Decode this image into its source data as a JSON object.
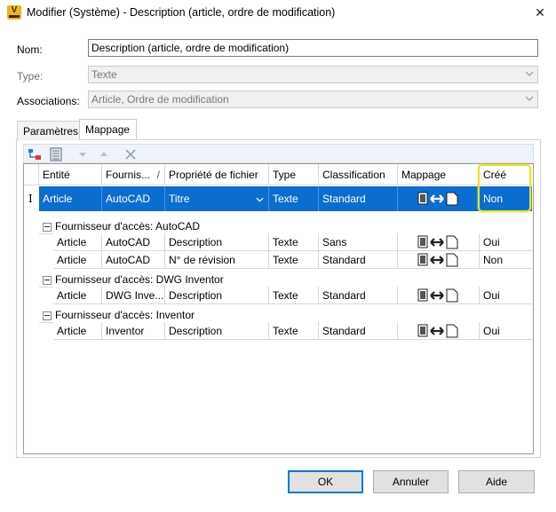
{
  "window": {
    "title": "Modifier (Système) - Description (article, ordre de modification)",
    "close_glyph": "✕",
    "app_icon_letter": "V"
  },
  "form": {
    "name_label": "Nom:",
    "name_value": "Description (article, ordre de modification)",
    "type_label": "Type:",
    "type_value": "Texte",
    "assoc_label": "Associations:",
    "assoc_value": "Article, Ordre de modification"
  },
  "tabs": [
    {
      "label": "Paramètres"
    },
    {
      "label": "Mappage"
    }
  ],
  "toolbar": {
    "icons": [
      "add-mapping-icon",
      "properties-icon",
      "move-down-icon",
      "move-up-icon",
      "delete-icon"
    ]
  },
  "grid": {
    "columns": [
      "Entité",
      "Fournis...",
      "Propriété de fichier",
      "Type",
      "Classification",
      "Mappage",
      "Créé"
    ],
    "sort_glyph": "/",
    "selected_row": {
      "entity": "Article",
      "provider": "AutoCAD",
      "property": "Titre",
      "type": "Texte",
      "classification": "Standard",
      "created": "Non"
    },
    "groups": [
      {
        "label": "Fournisseur d'accès: AutoCAD",
        "rows": [
          {
            "entity": "Article",
            "provider": "AutoCAD",
            "property": "Description",
            "type": "Texte",
            "classification": "Sans",
            "created": "Oui"
          },
          {
            "entity": "Article",
            "provider": "AutoCAD",
            "property": "N° de révision",
            "type": "Texte",
            "classification": "Standard",
            "created": "Non"
          }
        ]
      },
      {
        "label": "Fournisseur d'accès: DWG Inventor",
        "rows": [
          {
            "entity": "Article",
            "provider": "DWG Inve...",
            "property": "Description",
            "type": "Texte",
            "classification": "Standard",
            "created": "Oui"
          }
        ]
      },
      {
        "label": "Fournisseur d'accès: Inventor",
        "rows": [
          {
            "entity": "Article",
            "provider": "Inventor",
            "property": "Description",
            "type": "Texte",
            "classification": "Standard",
            "created": "Oui"
          }
        ]
      }
    ]
  },
  "buttons": {
    "ok": "OK",
    "cancel": "Annuler",
    "help": "Aide"
  },
  "colors": {
    "selection": "#0a6ed1",
    "highlight": "#e7e32a",
    "default_button_border": "#0078d7"
  }
}
